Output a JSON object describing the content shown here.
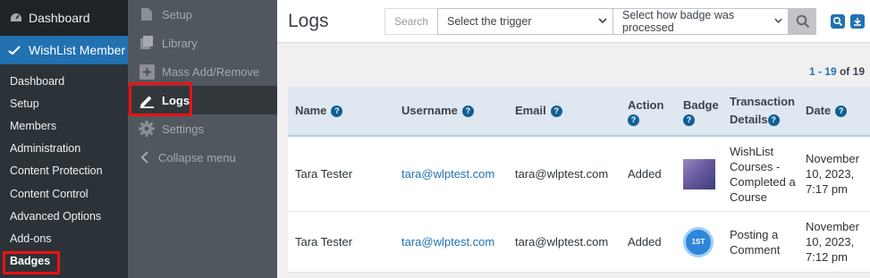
{
  "wp_menu": {
    "dashboard": "Dashboard",
    "current_plugin": "WishList Member",
    "submenu": [
      "Dashboard",
      "Setup",
      "Members",
      "Administration",
      "Content Protection",
      "Content Control",
      "Advanced Options",
      "Add-ons",
      "Badges"
    ]
  },
  "plugin_menu": {
    "items": [
      {
        "label": "Setup",
        "icon": "file-icon"
      },
      {
        "label": "Library",
        "icon": "library-icon"
      },
      {
        "label": "Mass Add/Remove",
        "icon": "plus-box-icon"
      },
      {
        "label": "Logs",
        "icon": "pencil-icon"
      },
      {
        "label": "Settings",
        "icon": "gear-icon"
      },
      {
        "label": "Collapse menu",
        "icon": "chevron-left-icon"
      }
    ]
  },
  "header": {
    "title": "Logs",
    "search_placeholder": "Search",
    "trigger_select": "Select the trigger",
    "processed_select": "Select how badge was processed"
  },
  "pager": {
    "range": "1 - 19",
    "of": "of",
    "total": "19"
  },
  "table": {
    "columns": {
      "name": "Name",
      "username": "Username",
      "email": "Email",
      "action": "Action",
      "badge": "Badge",
      "transaction_line1": "Transaction",
      "transaction_line2": "Details",
      "date": "Date"
    },
    "rows": [
      {
        "name": "Tara Tester",
        "username": "tara@wlptest.com",
        "email": "tara@wlptest.com",
        "action": "Added",
        "badge_icon": "gradient-badge-image",
        "transaction": [
          "WishList",
          "Courses -",
          "Completed a",
          "Course"
        ],
        "date": [
          "November",
          "10, 2023,",
          "7:17 pm"
        ]
      },
      {
        "name": "Tara Tester",
        "username": "tara@wlptest.com",
        "email": "tara@wlptest.com",
        "action": "Added",
        "badge_icon": "first-post-badge",
        "badge_text": "1ST",
        "transaction": [
          "Posting a",
          "Comment"
        ],
        "date": [
          "November",
          "10, 2023,",
          "7:12 pm"
        ]
      }
    ]
  },
  "colors": {
    "accent": "#2271b1",
    "highlight": "#ee1111"
  }
}
